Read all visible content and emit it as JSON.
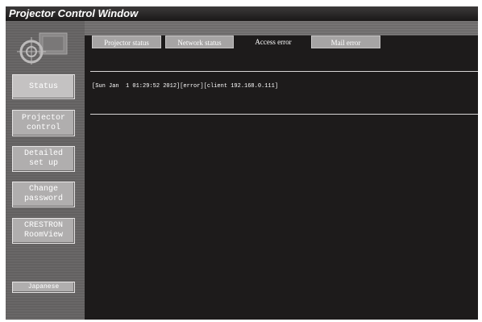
{
  "window": {
    "title": "Projector Control Window"
  },
  "sidebar": {
    "logo_icon": "projector-logo-icon",
    "items": [
      {
        "label": "Status"
      },
      {
        "label": "Projector\ncontrol"
      },
      {
        "label": "Detailed\nset up"
      },
      {
        "label": "Change\npassword"
      },
      {
        "label": "CRESTRON\nRoomView"
      }
    ],
    "language_button": "Japanese"
  },
  "tabs": [
    {
      "label": "Projector status"
    },
    {
      "label": "Network status"
    },
    {
      "label": "Access error",
      "selected": true
    },
    {
      "label": "Mail error"
    }
  ],
  "log": {
    "lines": [
      "[Sun Jan  1 01:29:52 2012][error][client 192.168.0.111]"
    ]
  },
  "colors": {
    "background": "#1d1b1b",
    "button": "#b0aeae",
    "text": "#ffffff"
  }
}
